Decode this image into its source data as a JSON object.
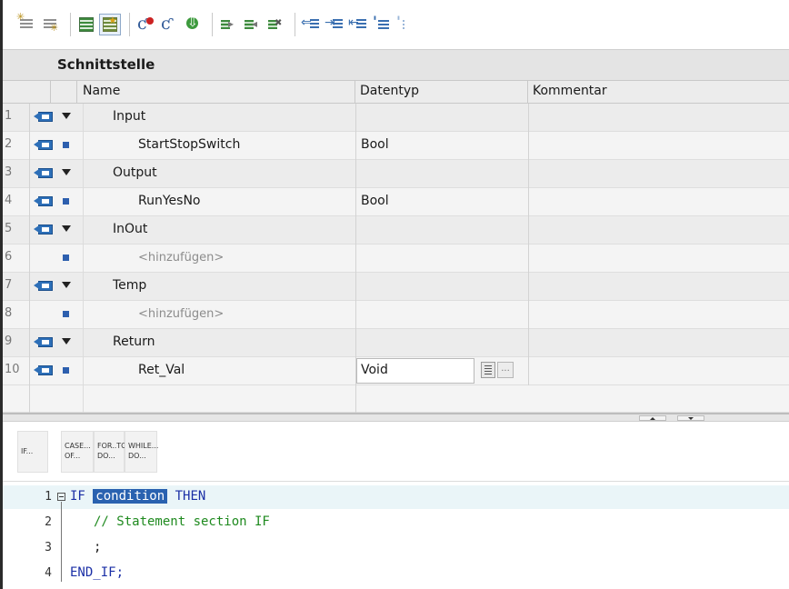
{
  "toolbar": {
    "buttons": [
      {
        "icon": "insert-row-icon"
      },
      {
        "icon": "add-row-icon"
      },
      {
        "icon": "show-interface-icon"
      },
      {
        "icon": "show-favorites-icon"
      },
      {
        "icon": "insert-call-icon"
      },
      {
        "icon": "delete-call-icon"
      },
      {
        "icon": "compile-icon"
      },
      {
        "icon": "monitor-start-icon"
      },
      {
        "icon": "monitor-stop-icon"
      },
      {
        "icon": "monitor-off-icon"
      },
      {
        "icon": "indent-icon"
      },
      {
        "icon": "increase-indent-icon"
      },
      {
        "icon": "decrease-indent-icon"
      },
      {
        "icon": "comment-icon"
      },
      {
        "icon": "uncomment-icon"
      }
    ]
  },
  "interface": {
    "title": "Schnittstelle",
    "columns": {
      "name": "Name",
      "datatype": "Datentyp",
      "comment": "Kommentar"
    },
    "rows": [
      {
        "num": "1",
        "name": "Input",
        "type": "",
        "kind": "section"
      },
      {
        "num": "2",
        "name": "StartStopSwitch",
        "type": "Bool",
        "kind": "item"
      },
      {
        "num": "3",
        "name": "Output",
        "type": "",
        "kind": "section"
      },
      {
        "num": "4",
        "name": "RunYesNo",
        "type": "Bool",
        "kind": "item"
      },
      {
        "num": "5",
        "name": "InOut",
        "type": "",
        "kind": "section"
      },
      {
        "num": "6",
        "name": "<hinzufügen>",
        "type": "",
        "kind": "placeholder"
      },
      {
        "num": "7",
        "name": "Temp",
        "type": "",
        "kind": "section"
      },
      {
        "num": "8",
        "name": "<hinzufügen>",
        "type": "",
        "kind": "placeholder"
      },
      {
        "num": "9",
        "name": "Return",
        "type": "",
        "kind": "section"
      },
      {
        "num": "10",
        "name": "Ret_Val",
        "type": "Void",
        "kind": "item-edit"
      }
    ],
    "edit_more_label": "..."
  },
  "palette": {
    "items": [
      {
        "label": "IF..."
      },
      {
        "label": "CASE... OF..."
      },
      {
        "label": "FOR..TO DO..."
      },
      {
        "label": "WHILE... DO..."
      }
    ]
  },
  "editor": {
    "lines": [
      {
        "num": "1",
        "kw1": "IF ",
        "placeholder": "condition",
        "kw2": " THEN"
      },
      {
        "num": "2",
        "text": "// Statement section IF"
      },
      {
        "num": "3",
        "text": ";"
      },
      {
        "num": "4",
        "text": "END_IF;"
      }
    ]
  },
  "colors": {
    "keyword": "#1b2fa6",
    "comment": "#1f8a1f",
    "selection": "#2a62b0",
    "io_icon": "#2d6fb8"
  }
}
